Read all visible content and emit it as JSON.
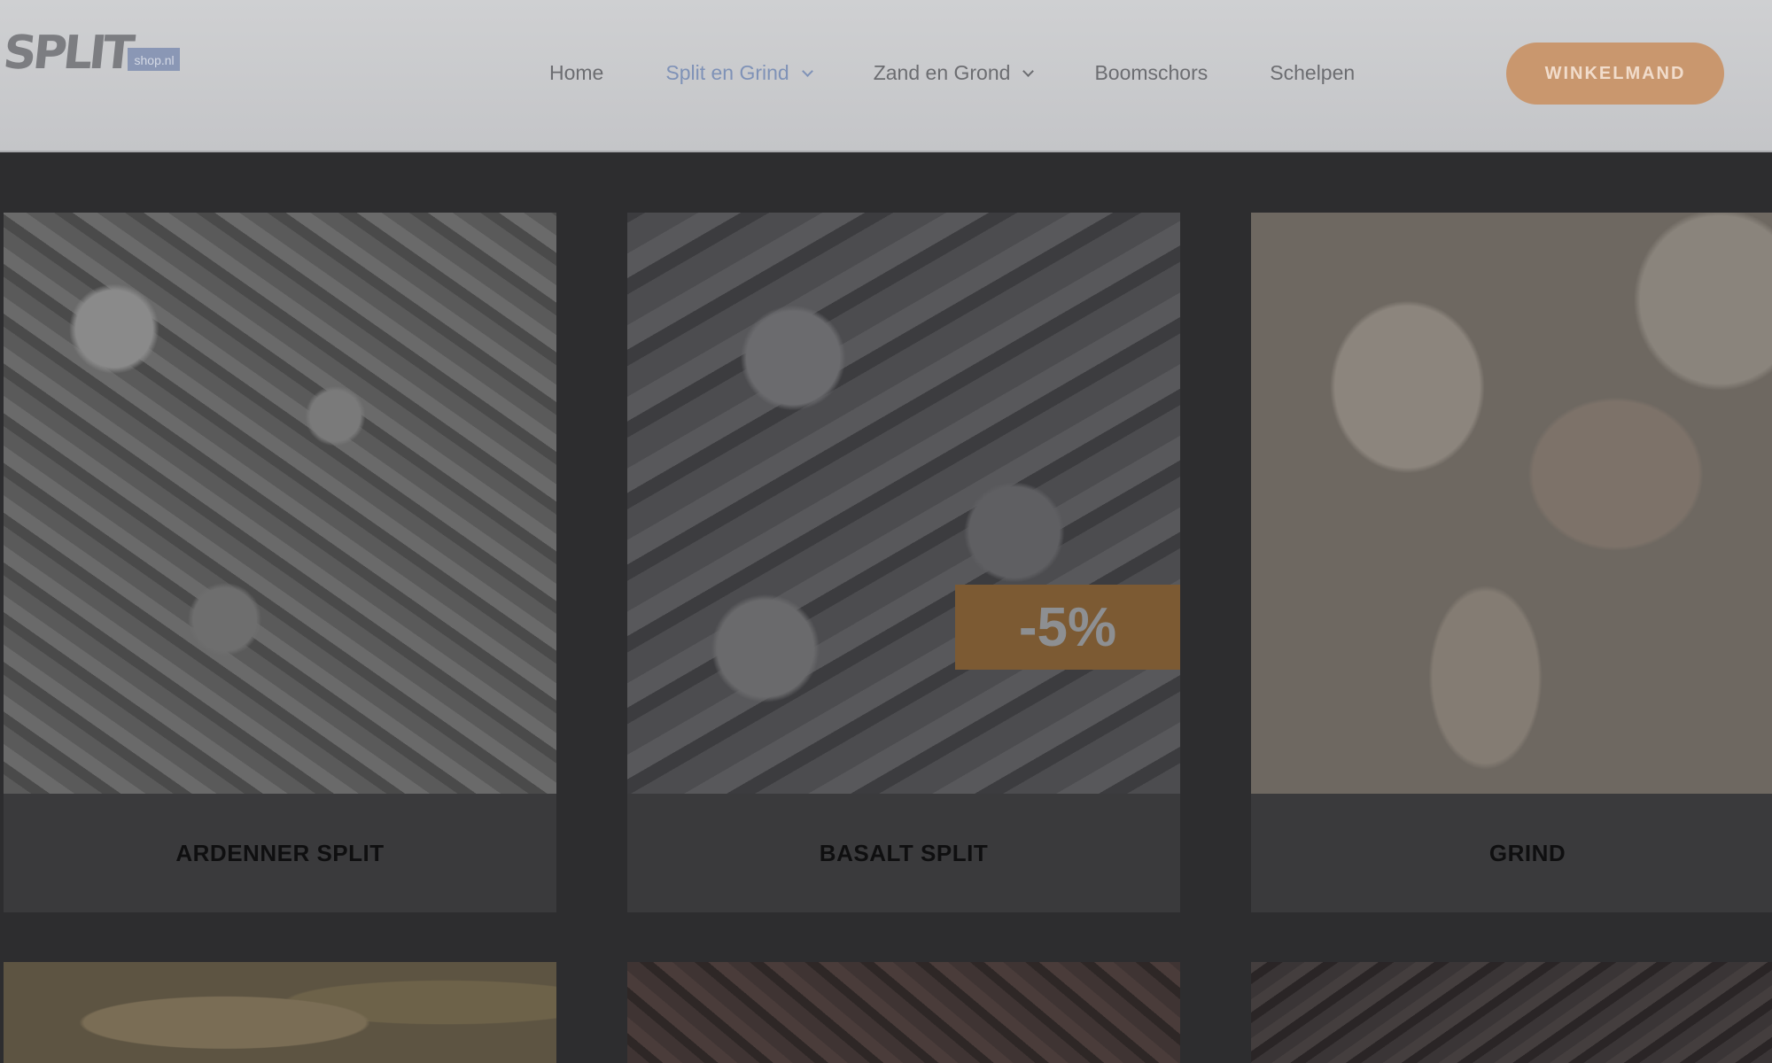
{
  "header": {
    "logo_text": "SPLIT",
    "logo_badge": "shop.nl",
    "nav": [
      {
        "label": "Home"
      },
      {
        "label": "Split en Grind"
      },
      {
        "label": "Zand en Grond"
      },
      {
        "label": "Boomschors"
      },
      {
        "label": "Schelpen"
      }
    ],
    "cart_label": "WINKELMAND"
  },
  "products": [
    {
      "title": "ARDENNER SPLIT"
    },
    {
      "title": "BASALT SPLIT",
      "badge": "-5%"
    },
    {
      "title": "GRIND"
    }
  ],
  "colors": {
    "accent": "#c9976e",
    "active_nav": "#7f92b7",
    "discount_badge": "#7c5a33"
  }
}
